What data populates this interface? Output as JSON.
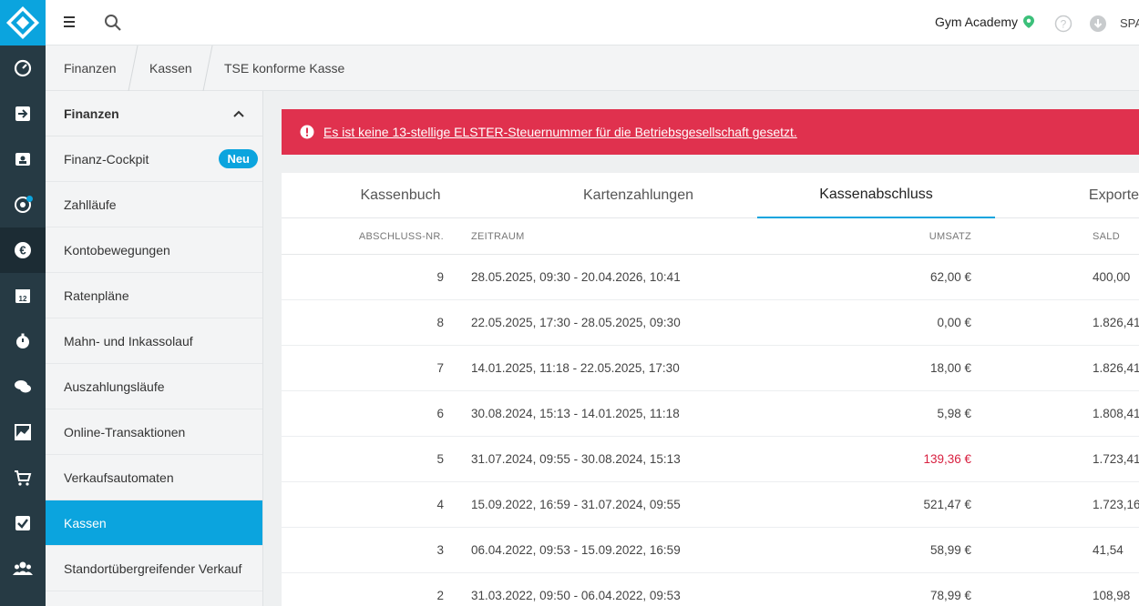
{
  "topbar": {
    "studio": "Gym Academy",
    "user": "SPA"
  },
  "breadcrumb": [
    "Finanzen",
    "Kassen",
    "TSE konforme Kasse"
  ],
  "sidebar": {
    "header": "Finanzen",
    "items": [
      {
        "label": "Finanz-Cockpit",
        "badge": "Neu"
      },
      {
        "label": "Zahlläufe"
      },
      {
        "label": "Kontobewegungen"
      },
      {
        "label": "Ratenpläne"
      },
      {
        "label": "Mahn- und Inkassolauf"
      },
      {
        "label": "Auszahlungsläufe"
      },
      {
        "label": "Online-Transaktionen"
      },
      {
        "label": "Verkaufsautomaten"
      },
      {
        "label": "Kassen"
      },
      {
        "label": "Standortübergreifender Verkauf"
      }
    ]
  },
  "alert": {
    "text": "Es ist keine 13-stellige ELSTER-Steuernummer für die Betriebsgesellschaft gesetzt."
  },
  "tabs": [
    "Kassenbuch",
    "Kartenzahlungen",
    "Kassenabschluss",
    "Exporte"
  ],
  "table": {
    "headers": [
      "ABSCHLUSS-NR.",
      "ZEITRAUM",
      "UMSATZ",
      "SALD"
    ],
    "rows": [
      {
        "nr": "9",
        "period": "28.05.2025, 09:30 - 20.04.2026, 10:41",
        "umsatz": "62,00 €",
        "saldo": "400,00"
      },
      {
        "nr": "8",
        "period": "22.05.2025, 17:30 - 28.05.2025, 09:30",
        "umsatz": "0,00 €",
        "saldo": "1.826,41"
      },
      {
        "nr": "7",
        "period": "14.01.2025, 11:18 - 22.05.2025, 17:30",
        "umsatz": "18,00 €",
        "saldo": "1.826,41"
      },
      {
        "nr": "6",
        "period": "30.08.2024, 15:13 - 14.01.2025, 11:18",
        "umsatz": "5,98 €",
        "saldo": "1.808,41"
      },
      {
        "nr": "5",
        "period": "31.07.2024, 09:55 - 30.08.2024, 15:13",
        "umsatz": "139,36 €",
        "saldo": "1.723,41"
      },
      {
        "nr": "4",
        "period": "15.09.2022, 16:59 - 31.07.2024, 09:55",
        "umsatz": "521,47 €",
        "saldo": "1.723,16"
      },
      {
        "nr": "3",
        "period": "06.04.2022, 09:53 - 15.09.2022, 16:59",
        "umsatz": "58,99 €",
        "saldo": "41,54"
      },
      {
        "nr": "2",
        "period": "31.03.2022, 09:50 - 06.04.2022, 09:53",
        "umsatz": "78,99 €",
        "saldo": "108,98"
      }
    ]
  },
  "colors": {
    "accent": "#0ba4de",
    "alert": "#e0314e",
    "negative": "#d81f3f",
    "rail": "#263a44"
  }
}
